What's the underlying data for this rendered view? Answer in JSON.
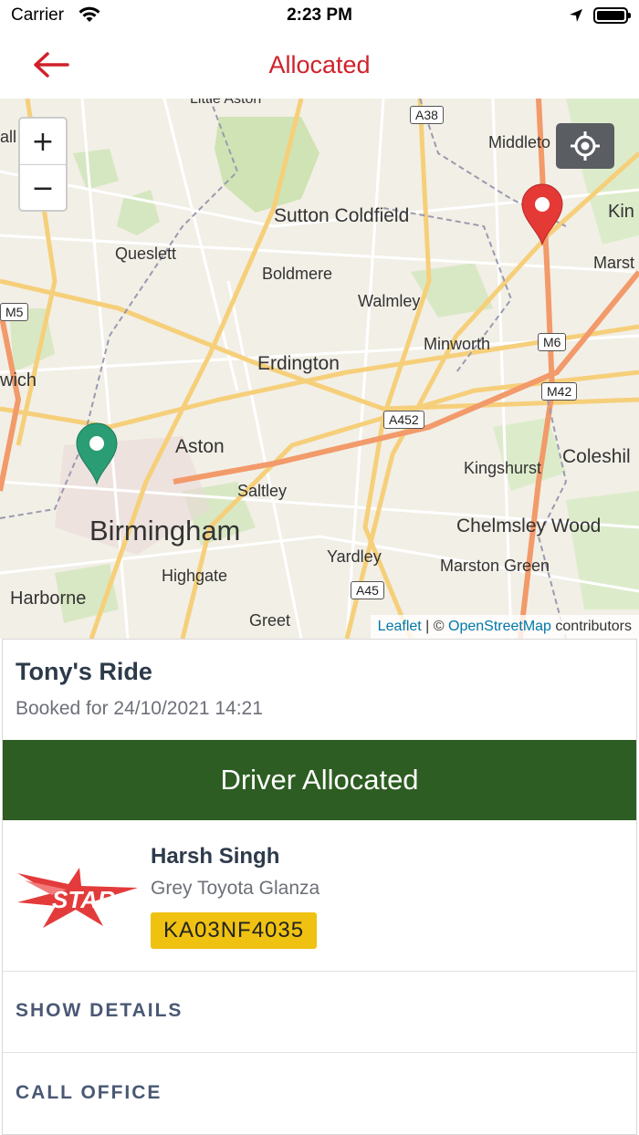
{
  "status_bar": {
    "carrier": "Carrier",
    "time": "2:23 PM"
  },
  "nav": {
    "title": "Allocated",
    "back_icon": "arrow-left-icon",
    "accent": "#d0212b"
  },
  "map": {
    "zoom_in": "+",
    "zoom_out": "−",
    "locate_icon": "crosshair-icon",
    "labels": [
      "Little Aston",
      "Middleto",
      "Sutton Coldfield",
      "Kin",
      "Queslett",
      "Boldmere",
      "Marst",
      "Walmley",
      "Minworth",
      "Erdington",
      "wich",
      "Aston",
      "Kingshurst",
      "Coleshil",
      "Saltley",
      "Birmingham",
      "Chelmsley Wood",
      "Yardley",
      "Highgate",
      "Marston Green",
      "Harborne",
      "Greet",
      "all"
    ],
    "shields": [
      "A38",
      "M5",
      "M6",
      "M42",
      "A452",
      "A45"
    ],
    "attribution": {
      "leaflet": "Leaflet",
      "sep": " | © ",
      "osm": "OpenStreetMap",
      "rest": " contributors"
    },
    "pickup_color": "#2a9d75",
    "dropoff_color": "#e53935"
  },
  "ride": {
    "title": "Tony's Ride",
    "booked": "Booked for 24/10/2021 14:21",
    "status": "Driver Allocated",
    "status_color": "#2d5d22"
  },
  "driver": {
    "logo_text": "STAR",
    "name": "Harsh Singh",
    "car": "Grey Toyota Glanza",
    "plate": "KA03NF4035",
    "plate_color": "#efc211"
  },
  "actions": {
    "show_details": "SHOW DETAILS",
    "call_office": "CALL OFFICE"
  }
}
